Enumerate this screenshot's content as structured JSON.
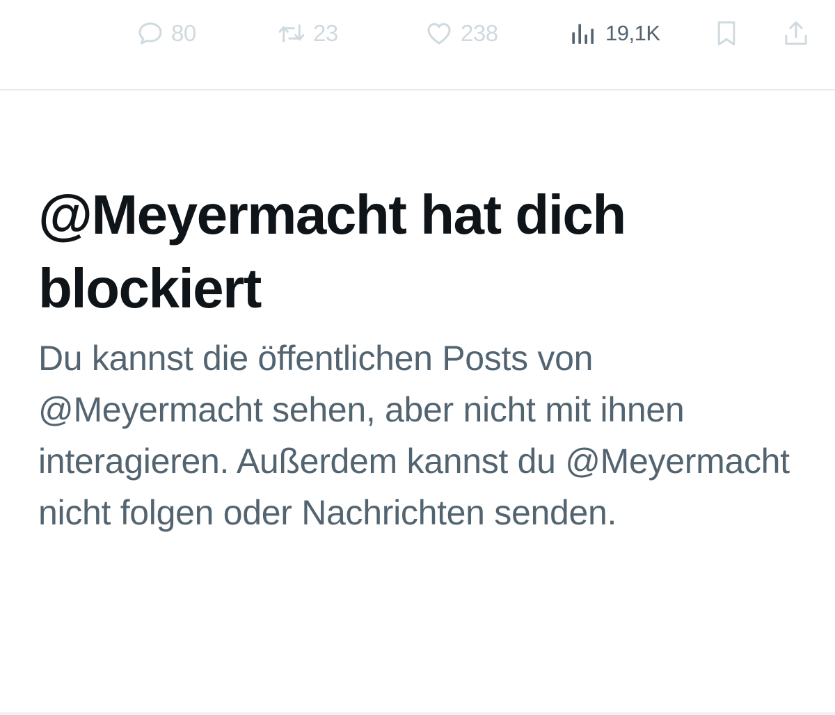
{
  "action_bar": {
    "reply": {
      "icon": "reply-icon",
      "count": "80"
    },
    "repost": {
      "icon": "repost-icon",
      "count": "23"
    },
    "like": {
      "icon": "heart-icon",
      "count": "238"
    },
    "views": {
      "icon": "views-chart-icon",
      "count": "19,1K"
    },
    "bookmark": {
      "icon": "bookmark-icon"
    },
    "share": {
      "icon": "share-icon"
    }
  },
  "block_notice": {
    "title": "@Meyermacht hat dich blockiert",
    "body": "Du kannst die öffentlichen Posts von @Meyermacht sehen, aber nicht mit ihnen interagieren. Außerdem kannst du @Meyermacht nicht folgen oder Nachrichten senden."
  },
  "colors": {
    "title_text": "#0f1419",
    "body_text": "#536471",
    "disabled_action": "#cfd9de",
    "divider": "#e6e9ec"
  }
}
